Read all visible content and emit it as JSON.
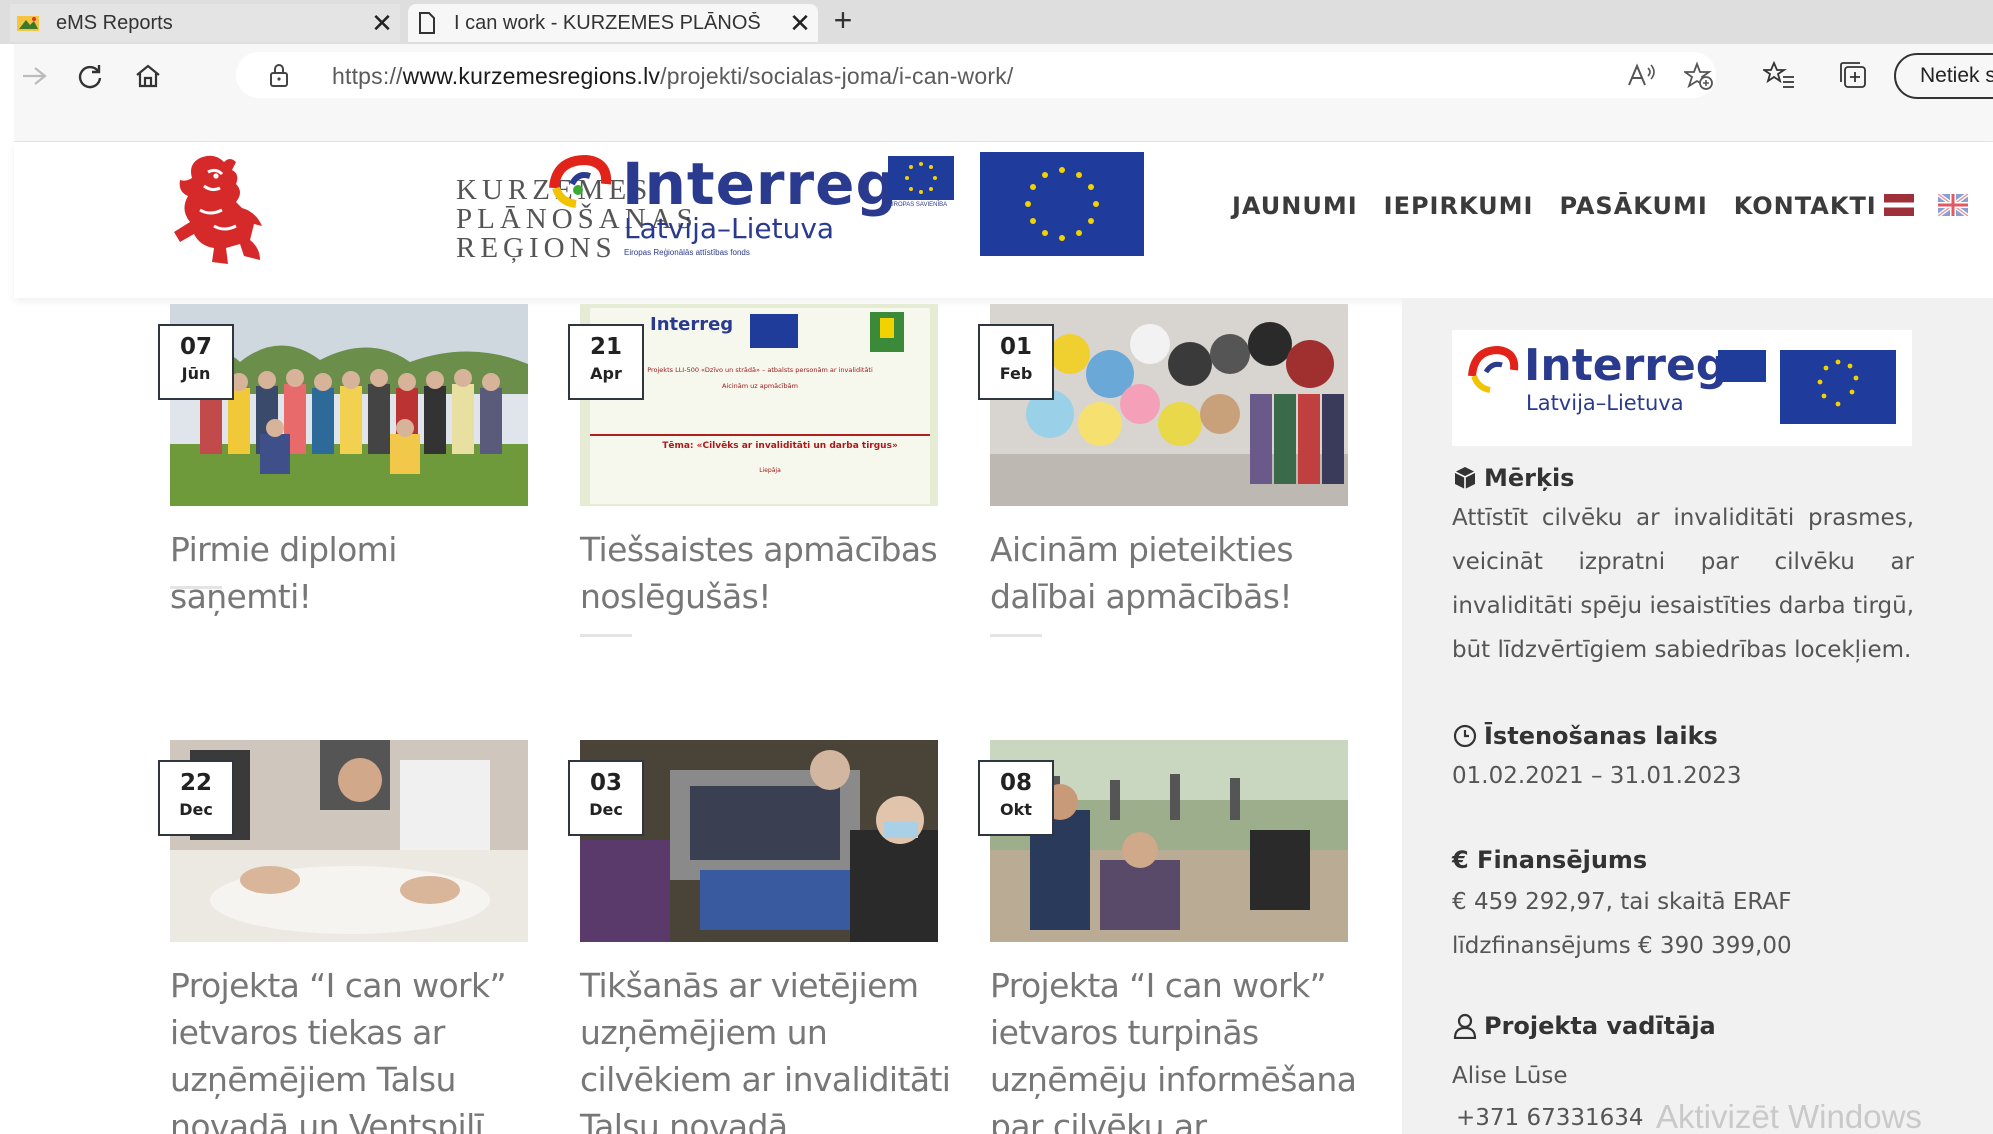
{
  "browser": {
    "tabs": [
      {
        "title": "eMS Reports",
        "active": false
      },
      {
        "title": "I can work - KURZEMES PLĀNOŠ",
        "active": true
      }
    ],
    "new_tab": "+",
    "close_glyph": "✕",
    "url_prefix": "https://",
    "url_host": "www.kurzemesregions.lv",
    "url_path": "/projekti/socialas-joma/i-can-work/",
    "profile_label": "Netiek s",
    "icons": [
      "back-icon",
      "refresh-icon",
      "home-icon",
      "lock-icon",
      "read-aloud-icon",
      "add-favorite-icon",
      "favorites-icon",
      "collections-icon"
    ]
  },
  "header": {
    "kpr_lines": [
      "KURZEMES",
      "PLĀNOŠANAS",
      "REĢIONS"
    ],
    "interreg_word": "Interreg",
    "interreg_sub": "Latvija–Lietuva",
    "interreg_tiny": "Eiropas Reģionālās attīstības fonds",
    "eu_mini_text": "EIROPAS SAVIENĪBA",
    "nav": [
      "JAUNUMI",
      "IEPIRKUMI",
      "PASĀKUMI",
      "KONTAKTI"
    ],
    "colors": {
      "nav": "#3b3b3b",
      "interreg_blue": "#2a3a8f",
      "eu_blue": "#1f3c9c",
      "lion_red": "#d62a2a"
    }
  },
  "posts": [
    {
      "day": "07",
      "month": "Jūn",
      "title": "Pirmie diplomi saņemti!"
    },
    {
      "day": "21",
      "month": "Apr",
      "title": "Tiešsaistes apmācības noslēgušās!"
    },
    {
      "day": "01",
      "month": "Feb",
      "title": "Aicinām pieteikties dalībai apmācībās!"
    },
    {
      "day": "22",
      "month": "Dec",
      "title": "Projekta “I can work” ietvaros tiekas ar uzņēmējiem Talsu novadā un Ventspilī"
    },
    {
      "day": "03",
      "month": "Dec",
      "title": "Tikšanās ar vietējiem uzņēmējiem un cilvēkiem ar invaliditāti Talsu novadā"
    },
    {
      "day": "08",
      "month": "Okt",
      "title": "Projekta “I can work” ietvaros turpinās uzņēmēju informēšana par cilvēku ar"
    }
  ],
  "poster": {
    "brand": "Interreg",
    "line1": "Projekts LLI-500 «Dzīvo un strādā» – atbalsts personām ar invaliditāti",
    "line2": "Aicinām uz apmācībām",
    "theme": "Tēma: «Cilvēks ar invaliditāti un darba tirgus»",
    "footer": "Liepāja"
  },
  "sidebar": {
    "goal_heading": "Mērķis",
    "goal_text": "Attīstīt cilvēku ar invaliditāti prasmes, veicināt izpratni par cilvēku ar invaliditāti spēju iesaistīties darba tirgū, būt līdzvērtīgiem sabiedrības locekļiem.",
    "period_heading": "Īstenošanas laiks",
    "period_text": "01.02.2021 – 31.01.2023",
    "funding_heading": "€ Finansējums",
    "funding_lines": [
      "€ 459 292,97, tai skaitā ERAF",
      "līdzfinansējums € 390 399,00"
    ],
    "lead_heading": "Projekta vadītāja",
    "lead_name": "Alise Lūse",
    "lead_phone": "+371 67331634"
  },
  "watermark": "Aktivizēt Windows"
}
